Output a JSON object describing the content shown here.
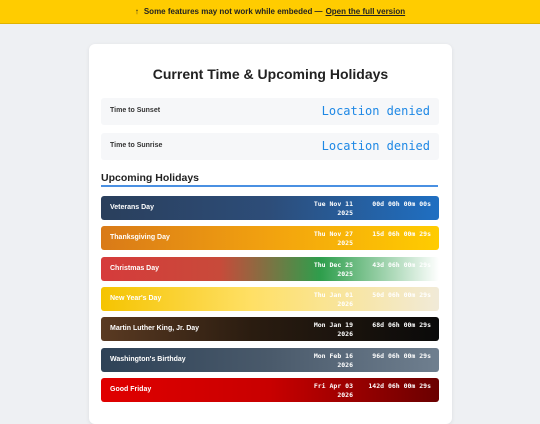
{
  "banner": {
    "icon": "up-arrow-icon",
    "message": "Some features may not work while embeded —",
    "link_text": "Open the full version"
  },
  "page_title": "Current Time & Upcoming Holidays",
  "sun": {
    "sunset_label": "Time to Sunset",
    "sunset_value": "Location denied",
    "sunrise_label": "Time to Sunrise",
    "sunrise_value": "Location denied"
  },
  "holidays_title": "Upcoming Holidays",
  "holidays": [
    {
      "name": "Veterans Day",
      "date_line1": "Tue Nov 11",
      "date_line2": "2025",
      "countdown": "00d 00h 00m 00s"
    },
    {
      "name": "Thanksgiving Day",
      "date_line1": "Thu Nov 27",
      "date_line2": "2025",
      "countdown": "15d 06h 00m 29s"
    },
    {
      "name": "Christmas Day",
      "date_line1": "Thu Dec 25",
      "date_line2": "2025",
      "countdown": "43d 06h 00m 29s"
    },
    {
      "name": "New Year's Day",
      "date_line1": "Thu Jan 01",
      "date_line2": "2026",
      "countdown": "50d 06h 00m 29s"
    },
    {
      "name": "Martin Luther King, Jr. Day",
      "date_line1": "Mon Jan 19",
      "date_line2": "2026",
      "countdown": "68d 06h 00m 29s"
    },
    {
      "name": "Washington's Birthday",
      "date_line1": "Mon Feb 16",
      "date_line2": "2026",
      "countdown": "96d 06h 00m 29s"
    },
    {
      "name": "Good Friday",
      "date_line1": "Fri Apr 03",
      "date_line2": "2026",
      "countdown": "142d 06h 00m 29s"
    }
  ],
  "colors": {
    "banner": "#ffcc00",
    "accent": "#1e88e5",
    "section_underline": "#4a90e2"
  }
}
